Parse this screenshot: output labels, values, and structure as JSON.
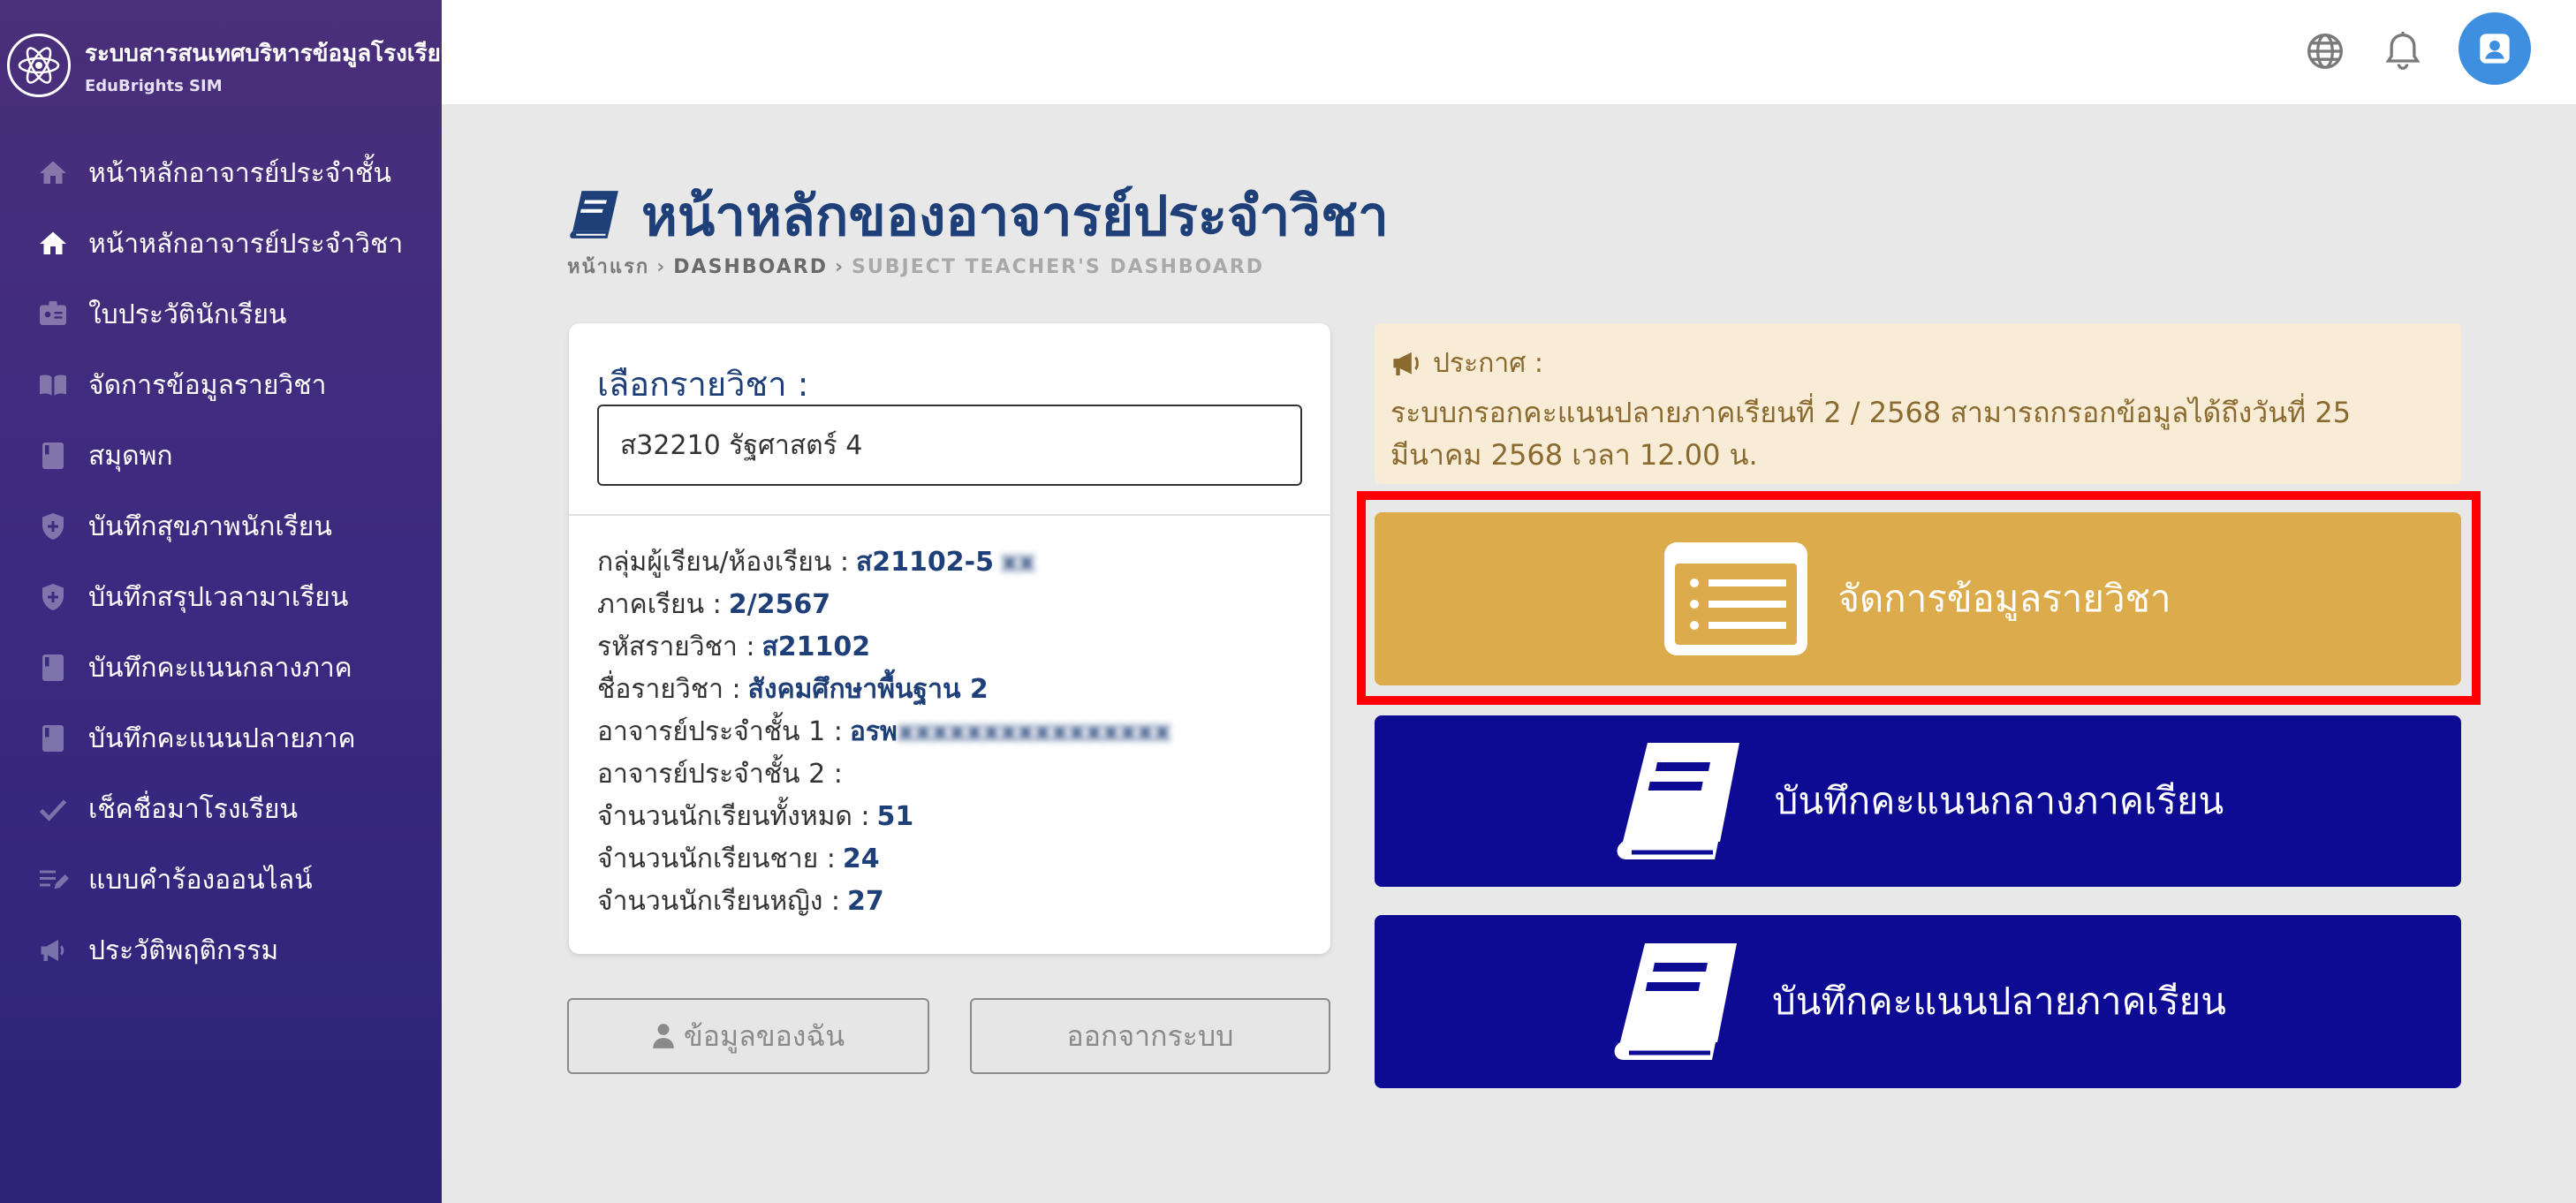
{
  "brand": {
    "title": "ระบบสารสนเทศบริหารข้อมูลโรงเรียน",
    "subtitle": "EduBrights SIM"
  },
  "sidebar": {
    "items": [
      {
        "label": "หน้าหลักอาจารย์ประจำชั้น",
        "icon": "home-icon"
      },
      {
        "label": "หน้าหลักอาจารย์ประจำวิชา",
        "icon": "home-icon",
        "active": true
      },
      {
        "label": "ใบประวัตินักเรียน",
        "icon": "id-card-icon"
      },
      {
        "label": "จัดการข้อมูลรายวิชา",
        "icon": "book-open-icon"
      },
      {
        "label": "สมุดพก",
        "icon": "book-icon"
      },
      {
        "label": "บันทึกสุขภาพนักเรียน",
        "icon": "shield-plus-icon"
      },
      {
        "label": "บันทึกสรุปเวลามาเรียน",
        "icon": "shield-plus-icon"
      },
      {
        "label": "บันทึกคะแนนกลางภาค",
        "icon": "book-icon"
      },
      {
        "label": "บันทึกคะแนนปลายภาค",
        "icon": "book-icon"
      },
      {
        "label": "เช็คชื่อมาโรงเรียน",
        "icon": "check-icon"
      },
      {
        "label": "แบบคำร้องออนไลน์",
        "icon": "edit-list-icon"
      },
      {
        "label": "ประวัติพฤติกรรม",
        "icon": "megaphone-icon"
      }
    ]
  },
  "topbar": {
    "icons": [
      "globe-icon",
      "bell-icon",
      "user-avatar-icon"
    ]
  },
  "page": {
    "title": "หน้าหลักของอาจารย์ประจำวิชา",
    "breadcrumb": [
      "หน้าแรก",
      "DASHBOARD",
      "SUBJECT TEACHER'S DASHBOARD"
    ]
  },
  "subject_card": {
    "label": "เลือกรายวิชา :",
    "selected": "ส32210 รัฐศาสตร์ 4",
    "info": [
      {
        "label": "กลุ่มผู้เรียน/ห้องเรียน :",
        "value": "ส21102-5"
      },
      {
        "label": "ภาคเรียน :",
        "value": "2/2567"
      },
      {
        "label": "รหัสรายวิชา :",
        "value": "ส21102"
      },
      {
        "label": "ชื่อรายวิชา :",
        "value": "สังคมศึกษาพื้นฐาน 2"
      },
      {
        "label": "อาจารย์ประจำชั้น 1 :",
        "value": "อรพ"
      },
      {
        "label": "อาจารย์ประจำชั้น 2 :",
        "value": ""
      },
      {
        "label": "จำนวนนักเรียนทั้งหมด :",
        "value": "51"
      },
      {
        "label": "จำนวนนักเรียนชาย :",
        "value": "24"
      },
      {
        "label": "จำนวนนักเรียนหญิง :",
        "value": "27"
      }
    ]
  },
  "buttons": {
    "profile": "ข้อมูลของฉัน",
    "logout": "ออกจากระบบ"
  },
  "announcement": {
    "heading": "ประกาศ :",
    "text": "ระบบกรอกคะแนนปลายภาคเรียนที่ 2 / 2568 สามารถกรอกข้อมูลได้ถึงวันที่ 25 มีนาคม 2568 เวลา 12.00 น."
  },
  "tiles": [
    {
      "label": "จัดการข้อมูลรายวิชา",
      "icon": "list-icon",
      "color": "#dcab4c"
    },
    {
      "label": "บันทึกคะแนนกลางภาคเรียน",
      "icon": "book-icon",
      "color": "#0d0a94"
    },
    {
      "label": "บันทึกคะแนนปลายภาคเรียน",
      "icon": "book-icon",
      "color": "#0d0a94"
    }
  ],
  "colors": {
    "sidebar": "#3b2a80",
    "title": "#1e3f78",
    "highlight": "#ff0000"
  }
}
